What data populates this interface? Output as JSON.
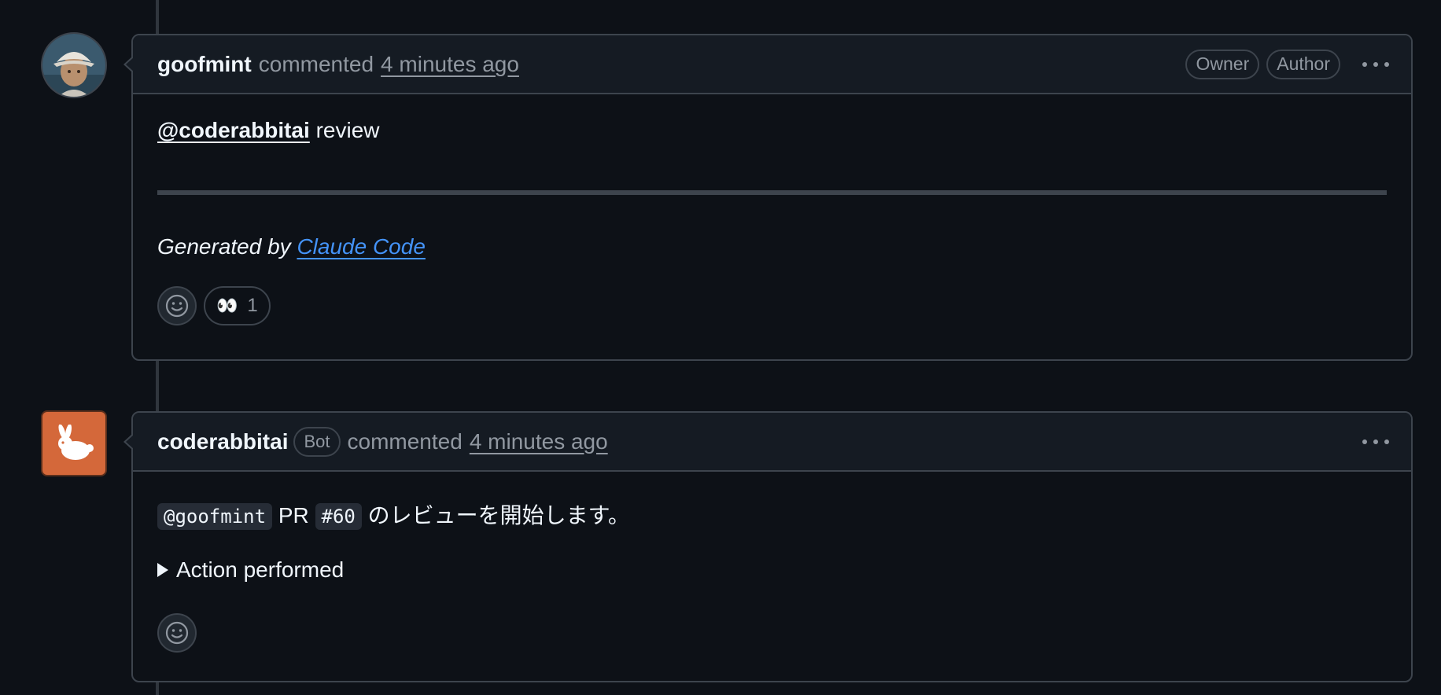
{
  "comments": [
    {
      "author": "goofmint",
      "action": "commented",
      "time": "4 minutes ago",
      "labels": [
        "Owner",
        "Author"
      ],
      "mention": "@coderabbitai",
      "text": " review",
      "generated_prefix": "Generated by ",
      "generated_link": "Claude Code",
      "reactions": [
        {
          "emoji": "👀",
          "count": "1"
        }
      ]
    },
    {
      "author": "coderabbitai",
      "bot_label": "Bot",
      "action": "commented",
      "time": "4 minutes ago",
      "mention_code": "@goofmint",
      "text_mid": " PR ",
      "pr_code": "#60",
      "text_end": " のレビューを開始します。",
      "details_summary": "Action performed"
    }
  ],
  "colors": {
    "background": "#0d1117",
    "header_bg": "#151b23",
    "border": "#3d444d",
    "link": "#4493f8",
    "bot_avatar": "#d4683a"
  }
}
